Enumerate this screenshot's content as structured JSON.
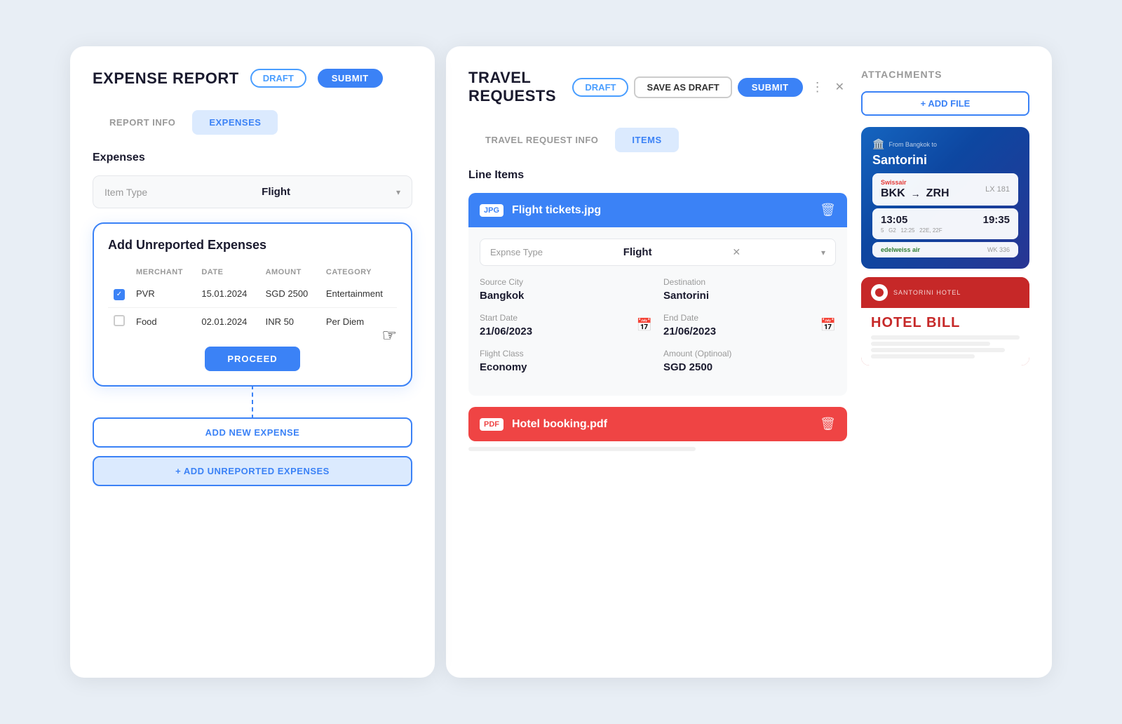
{
  "left": {
    "title": "EXPENSE REPORT",
    "draft_label": "DRAFT",
    "submit_label": "SUBMIT",
    "tab_report_info": "REPORT INFO",
    "tab_expenses": "EXPENSES",
    "section_expenses": "Expenses",
    "item_type_label": "Item Type",
    "item_type_value": "Flight",
    "unreported": {
      "title": "Add Unreported Expenses",
      "col_checkbox": "",
      "col_merchant": "MERCHANT",
      "col_date": "DATE",
      "col_amount": "AMOUNT",
      "col_category": "CATEGORY",
      "rows": [
        {
          "merchant": "PVR",
          "date": "15.01.2024",
          "amount": "SGD 2500",
          "category": "Entertainment",
          "checked": true
        },
        {
          "merchant": "Food",
          "date": "02.01.2024",
          "amount": "INR 50",
          "category": "Per Diem",
          "checked": false
        }
      ],
      "proceed_label": "PROCEED"
    },
    "add_expense_label": "ADD NEW EXPENSE",
    "add_unreported_label": "+ ADD UNREPORTED EXPENSES"
  },
  "right": {
    "title": "TRAVEL REQUESTS",
    "draft_label": "DRAFT",
    "save_draft_label": "SAVE AS DRAFT",
    "submit_label": "SUBMIT",
    "tab_info": "TRAVEL REQUEST INFO",
    "tab_items": "ITEMS",
    "line_items_title": "Line Items",
    "flight_file": {
      "badge": "JPG",
      "name": "Flight tickets.jpg",
      "expense_type_label": "Expnse Type",
      "expense_type_value": "Flight",
      "source_city_label": "Source City",
      "source_city_value": "Bangkok",
      "destination_label": "Destination",
      "destination_value": "Santorini",
      "start_date_label": "Start Date",
      "start_date_value": "21/06/2023",
      "end_date_label": "End Date",
      "end_date_value": "21/06/2023",
      "flight_class_label": "Flight Class",
      "flight_class_value": "Economy",
      "amount_label": "Amount (Optinoal)",
      "amount_value": "SGD 2500"
    },
    "hotel_file": {
      "badge": "PDF",
      "name": "Hotel booking.pdf"
    }
  },
  "attachments": {
    "title": "ATTACHMENTS",
    "add_file_label": "+ ADD FILE",
    "santorini": {
      "from_label": "From Bangkok to",
      "headline": "Santorini",
      "airline": "Swissair",
      "flight_number": "LX 181",
      "from_code": "BKK",
      "to_code": "ZRH",
      "depart_time": "13:05",
      "arrive_time": "19:35",
      "terminal": "5",
      "gate": "G2",
      "boarding": "12:25",
      "seat": "22E, 22F",
      "edelweiss": "edelweiss air",
      "edelweiss_flight": "WK 336"
    },
    "hotel": {
      "name": "SANTORINI HOTEL",
      "bill_title": "HOTEL BILL"
    }
  }
}
